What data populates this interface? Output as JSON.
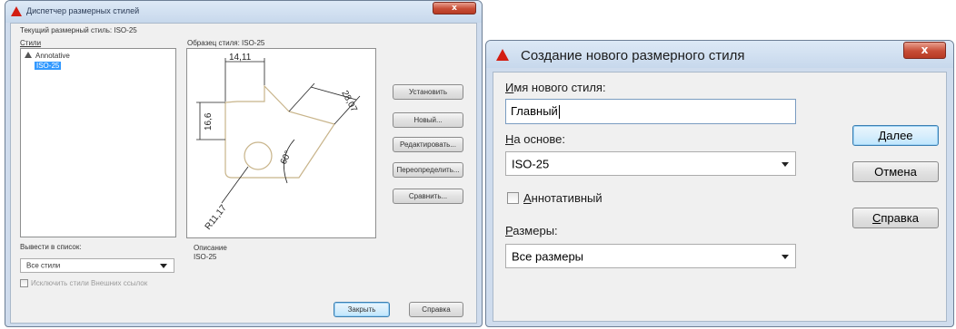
{
  "dim_styles_dialog": {
    "title": "Диспетчер размерных стилей",
    "current_style_text": "Текущий размерный стиль: ISO-25",
    "styles_label": "Стили",
    "styles_list": [
      "Annotative",
      "ISO-25"
    ],
    "selected_style": "ISO-25",
    "preview_label": "Образец стиля: ISO-25",
    "preview_dims": {
      "top": "14,11",
      "left": "16,6",
      "diag": "28,07",
      "angle": "60°",
      "radius": "R11,17"
    },
    "buttons": {
      "set_current": "Установить",
      "new": "Новый...",
      "modify": "Редактировать...",
      "override": "Переопределить...",
      "compare": "Сравнить..."
    },
    "list_filter_label": "Вывести в список:",
    "list_filter_value": "Все стили",
    "xref_checkbox_label": "Исключить стили Внешних ссылок",
    "description_label": "Описание",
    "description_value": "ISO-25",
    "close_button": "Закрыть",
    "help_button": "Справка"
  },
  "new_style_dialog": {
    "title": "Создание нового размерного стиля",
    "close_glyph": "x",
    "name_label_u": "И",
    "name_label_rest": "мя нового стиля:",
    "name_value": "Главный",
    "based_on_label_u": "Н",
    "based_on_label_rest": "а основе:",
    "based_on_value": "ISO-25",
    "annotative_u": "А",
    "annotative_rest": "ннотативный",
    "sizes_label_u": "Р",
    "sizes_label_rest": "азмеры:",
    "sizes_value": "Все размеры",
    "next_u": "Д",
    "next_rest": "алее",
    "cancel_button": "Отмена",
    "help_u": "С",
    "help_rest": "правка"
  },
  "colors": {
    "accent_red": "#d31d12",
    "selection": "#3399ff",
    "dim_line": "#222222",
    "part_line": "#c8b48a"
  }
}
